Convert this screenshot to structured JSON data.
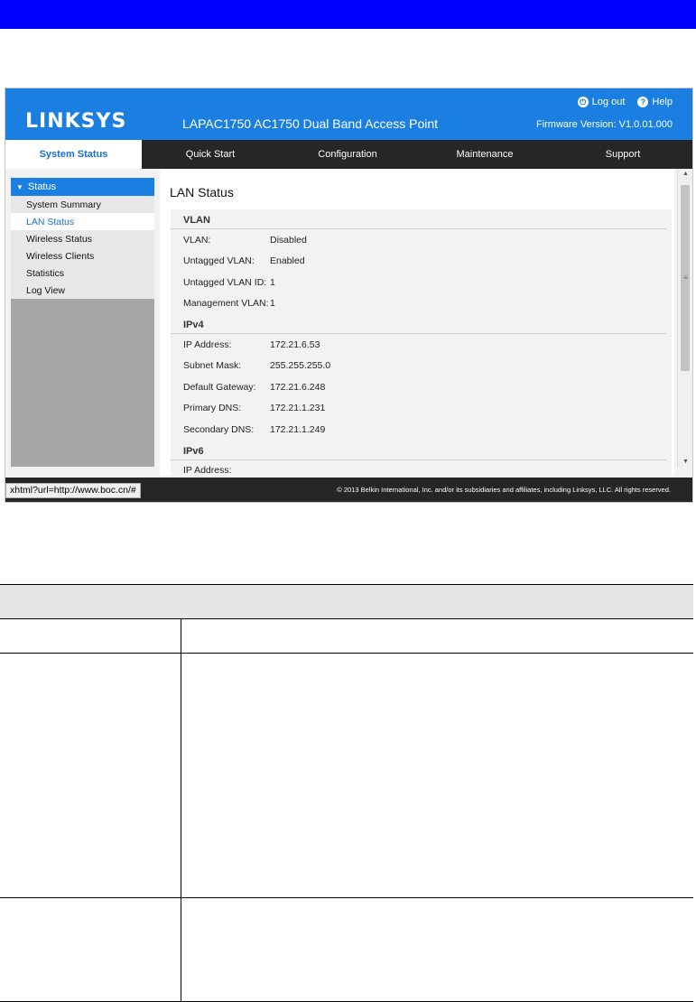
{
  "header": {
    "logo_text": "LINKSYS",
    "product_title": "LAPAC1750 AC1750 Dual Band Access Point",
    "firmware": "Firmware Version: V1.0.01.000",
    "logout_label": "Log out",
    "help_label": "Help"
  },
  "nav": {
    "tabs": [
      {
        "label": "System Status",
        "active": true
      },
      {
        "label": "Quick Start"
      },
      {
        "label": "Configuration"
      },
      {
        "label": "Maintenance"
      },
      {
        "label": "Support"
      }
    ]
  },
  "sidebar": {
    "group_label": "Status",
    "items": [
      {
        "label": "System Summary"
      },
      {
        "label": "LAN Status",
        "active": true
      },
      {
        "label": "Wireless Status"
      },
      {
        "label": "Wireless Clients"
      },
      {
        "label": "Statistics"
      },
      {
        "label": "Log View"
      }
    ]
  },
  "content": {
    "title": "LAN Status",
    "vlan": {
      "section": "VLAN",
      "rows": [
        {
          "label": "VLAN:",
          "value": "Disabled"
        },
        {
          "label": "Untagged VLAN:",
          "value": "Enabled"
        },
        {
          "label": "Untagged VLAN ID:",
          "value": "1"
        },
        {
          "label": "Management VLAN:",
          "value": "1"
        }
      ]
    },
    "ipv4": {
      "section": "IPv4",
      "rows": [
        {
          "label": "IP Address:",
          "value": "172.21.6.53"
        },
        {
          "label": "Subnet Mask:",
          "value": "255.255.255.0"
        },
        {
          "label": "Default Gateway:",
          "value": "172.21.6.248"
        },
        {
          "label": "Primary DNS:",
          "value": "172.21.1.231"
        },
        {
          "label": "Secondary DNS:",
          "value": "172.21.1.249"
        }
      ]
    },
    "ipv6": {
      "section": "IPv6",
      "partial_label": "IP Address:"
    }
  },
  "footer": {
    "copyright": "© 2013 Belkin International, Inc. and/or its subsidiaries and affiliates, including Linksys, LLC. All rights reserved.",
    "status_url": "xhtml?url=http://www.boc.cn/#"
  },
  "colors": {
    "accent_blue": "#1a7fe0",
    "page_banner": "#0000ff",
    "nav_dark": "#262626"
  }
}
